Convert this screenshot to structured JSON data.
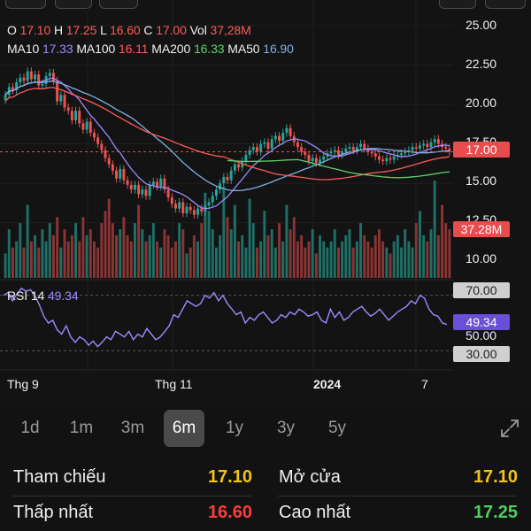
{
  "ohlc": {
    "o_label": "O",
    "o_value": "17.10",
    "h_label": "H",
    "h_value": "17.25",
    "l_label": "L",
    "l_value": "16.60",
    "c_label": "C",
    "c_value": "17.00",
    "vol_label": "Vol",
    "vol_value": "37,28M"
  },
  "ma": {
    "ma10_label": "MA10",
    "ma10_value": "17.33",
    "ma100_label": "MA100",
    "ma100_value": "16.11",
    "ma200_label": "MA200",
    "ma200_value": "16.33",
    "ma50_label": "MA50",
    "ma50_value": "16.90"
  },
  "rsi": {
    "label": "RSI 14",
    "value": "49.34"
  },
  "price_axis": [
    "25.00",
    "22.50",
    "20.00",
    "17.50",
    "15.00",
    "12.50",
    "10.00"
  ],
  "rsi_axis": [
    "70.00",
    "50.00",
    "30.00"
  ],
  "badges": {
    "price": "17.00",
    "volume": "37.28M",
    "rsi": "49.34",
    "rsi_high": "70.00",
    "rsi_low": "30.00"
  },
  "time_axis": [
    "Thg 9",
    "Thg 11",
    "2024",
    "7"
  ],
  "colors": {
    "up": "#26a69a",
    "down": "#ef5350",
    "ma10": "#9b8bff",
    "ma50": "#7fb1e6",
    "ma100": "#ff5a5a",
    "ma200": "#5dd36a",
    "price_badge": "#e84c4c",
    "rsi_badge": "#6a4fd8"
  },
  "ranges": {
    "labels": [
      "1d",
      "1m",
      "3m",
      "6m",
      "1y",
      "3y",
      "5y"
    ],
    "active": "6m"
  },
  "stats": {
    "reference_label": "Tham chiếu",
    "reference_value": "17.10",
    "open_label": "Mở cửa",
    "open_value": "17.10",
    "low_label": "Thấp nhất",
    "low_value": "16.60",
    "high_label": "Cao nhất",
    "high_value": "17.25"
  },
  "chart_data": {
    "type": "candlestick",
    "price_range": [
      9,
      25.5
    ],
    "rsi_range": [
      20,
      80
    ],
    "closes": [
      20.6,
      21.1,
      20.9,
      21.4,
      21.7,
      21.5,
      22.1,
      21.6,
      21.9,
      21.2,
      21.3,
      21.8,
      22.0,
      21.5,
      20.2,
      20.6,
      19.8,
      19.6,
      19.0,
      19.6,
      18.8,
      18.4,
      18.9,
      18.2,
      17.9,
      17.5,
      17.1,
      16.6,
      16.2,
      15.8,
      15.3,
      15.9,
      15.2,
      14.9,
      14.6,
      14.9,
      14.3,
      14.6,
      14.2,
      14.9,
      15.1,
      14.8,
      15.3,
      14.6,
      14.1,
      13.7,
      13.4,
      13.8,
      13.1,
      13.5,
      13.3,
      13.0,
      13.4,
      13.2,
      13.6,
      13.8,
      14.2,
      14.6,
      15.0,
      15.4,
      15.2,
      15.8,
      16.2,
      16.0,
      16.4,
      16.8,
      17.1,
      17.3,
      17.0,
      17.5,
      17.6,
      17.2,
      17.8,
      18.0,
      17.7,
      18.2,
      18.5,
      18.0,
      17.6,
      17.3,
      17.0,
      16.8,
      16.4,
      16.6,
      16.3,
      16.5,
      16.7,
      16.9,
      17.0,
      17.1,
      16.8,
      17.0,
      17.2,
      17.3,
      17.1,
      17.3,
      17.5,
      17.2,
      17.0,
      16.9,
      16.7,
      16.5,
      16.4,
      16.6,
      16.5,
      16.7,
      16.8,
      16.9,
      17.0,
      17.1,
      17.3,
      17.2,
      17.4,
      17.5,
      17.3,
      17.6,
      17.8,
      17.5,
      17.3,
      17.2,
      17.0
    ],
    "volumes": [
      4,
      8,
      5,
      6,
      9,
      5,
      12,
      6,
      7,
      5,
      8,
      6,
      9,
      7,
      10,
      5,
      8,
      6,
      7,
      9,
      6,
      10,
      7,
      8,
      6,
      5,
      9,
      11,
      13,
      9,
      7,
      8,
      10,
      7,
      6,
      9,
      12,
      8,
      6,
      7,
      9,
      6,
      5,
      8,
      7,
      5,
      6,
      9,
      8,
      4,
      5,
      7,
      6,
      9,
      14,
      11,
      8,
      5,
      7,
      15,
      10,
      8,
      12,
      6,
      7,
      5,
      13,
      9,
      5,
      6,
      11,
      7,
      8,
      5,
      9,
      6,
      12,
      8,
      10,
      6,
      7,
      5,
      6,
      8,
      4,
      7,
      6,
      5,
      6,
      8,
      5,
      6,
      7,
      8,
      5,
      6,
      9,
      7,
      6,
      5,
      7,
      8,
      6,
      5,
      4,
      6,
      7,
      5,
      8,
      6,
      5,
      9,
      11,
      7,
      6,
      8,
      16,
      7,
      12,
      9,
      8
    ],
    "rsi": [
      70,
      72,
      66,
      71,
      75,
      73,
      74,
      70,
      63,
      55,
      50,
      52,
      45,
      42,
      48,
      40,
      36,
      40,
      38,
      34,
      37,
      33,
      36,
      40,
      38,
      44,
      42,
      40,
      44,
      38,
      42,
      40,
      46,
      42,
      38,
      40,
      44,
      48,
      56,
      54,
      60,
      66,
      64,
      62,
      64,
      70,
      68,
      72,
      66,
      70,
      64,
      60,
      56,
      58,
      50,
      54,
      52,
      56,
      58,
      54,
      50,
      52,
      56,
      54,
      58,
      56,
      60,
      58,
      55,
      56,
      58,
      52,
      50,
      60,
      54,
      58,
      52,
      54,
      58,
      60,
      62,
      58,
      55,
      57,
      60,
      56,
      52,
      55,
      58,
      60,
      62,
      66,
      64,
      70,
      68,
      60,
      56,
      55,
      50,
      49
    ]
  }
}
